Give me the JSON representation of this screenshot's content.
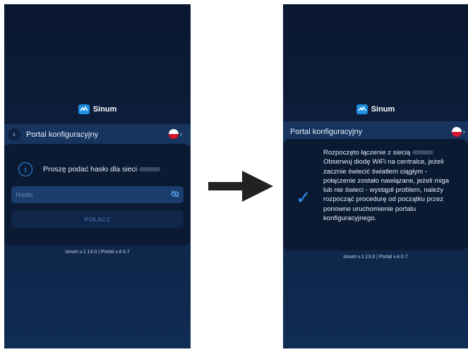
{
  "brand": {
    "name": "Sinum",
    "accent": "#1d8fe0"
  },
  "left_screen": {
    "header_title": "Portal konfiguracyjny",
    "info_text": "Proszę podać hasło dla sieci",
    "password_placeholder": "Hasło",
    "connect_label": "POŁĄCZ",
    "footer": "sinum v.1.13.0 | Portal v.4.0.7"
  },
  "right_screen": {
    "header_title": "Portal konfiguracyjny",
    "message_lines": [
      "Rozpoczęto łączenie z siecią",
      "Obserwuj diodę WiFi na centralce, jeżeli",
      "zacznie świecić światłem ciągłym -",
      "połączenie zostało nawiązane, jeżeli miga",
      "lub nie świeci - wystąpił problem, należy",
      "rozpocząć procedurę od początku przez",
      "ponowne uruchomienie portalu",
      "konfiguracyjnego."
    ],
    "footer": "sinum v.1.13.0 | Portal v.4.0.7"
  },
  "icons": {
    "back": "chevron-left-icon",
    "flag": "poland-flag-icon",
    "info": "info-icon",
    "visibility": "eye-off-icon",
    "success": "checkmark-icon",
    "transition": "arrow-right-icon"
  }
}
